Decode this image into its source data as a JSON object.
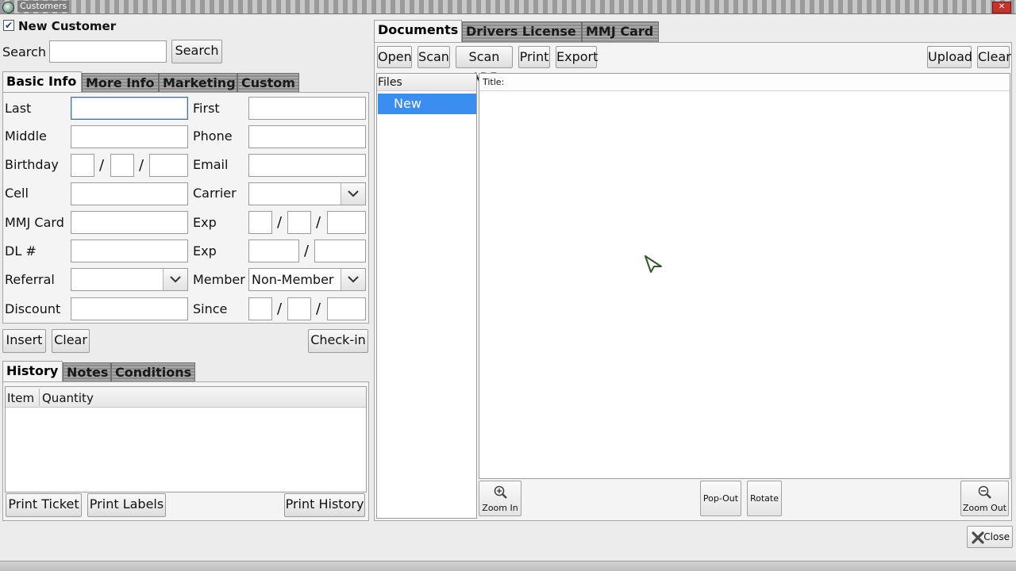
{
  "window": {
    "title": "Customers"
  },
  "customer": {
    "new_customer_label": "New Customer",
    "new_customer_checked": true,
    "search_label": "Search",
    "search_value": "",
    "search_button": "Search"
  },
  "info_tabs": [
    "Basic Info",
    "More Info",
    "Marketing",
    "Custom"
  ],
  "basic_info": {
    "last": "Last",
    "first": "First",
    "middle": "Middle",
    "phone": "Phone",
    "birthday": "Birthday",
    "email": "Email",
    "cell": "Cell",
    "carrier": "Carrier",
    "mmj_card": "MMJ Card",
    "exp": "Exp",
    "dl": "DL #",
    "exp2": "Exp",
    "referral": "Referral",
    "member": "Member",
    "member_value": "Non-Member",
    "discount": "Discount",
    "since": "Since",
    "slash": "/"
  },
  "actions": {
    "insert": "Insert",
    "clear": "Clear",
    "checkin": "Check-in"
  },
  "history_tabs": [
    "History",
    "Notes",
    "Conditions"
  ],
  "history": {
    "columns": [
      "Item",
      "Quantity"
    ],
    "print_ticket": "Print Ticket",
    "print_labels": "Print Labels",
    "print_history": "Print History"
  },
  "doc_tabs": [
    "Documents",
    "Drivers License",
    "MMJ Card"
  ],
  "doc_toolbar": {
    "open": "Open",
    "scan": "Scan",
    "scan_adf": "Scan ADF",
    "print": "Print",
    "export": "Export",
    "upload": "Upload",
    "clear": "Clear"
  },
  "files": {
    "header": "Files",
    "items": [
      "New"
    ]
  },
  "viewer": {
    "title_label": "Title:",
    "zoom_in": "Zoom In",
    "pop_out": "Pop-Out",
    "rotate": "Rotate",
    "zoom_out": "Zoom Out"
  },
  "footer": {
    "close": "Close"
  }
}
